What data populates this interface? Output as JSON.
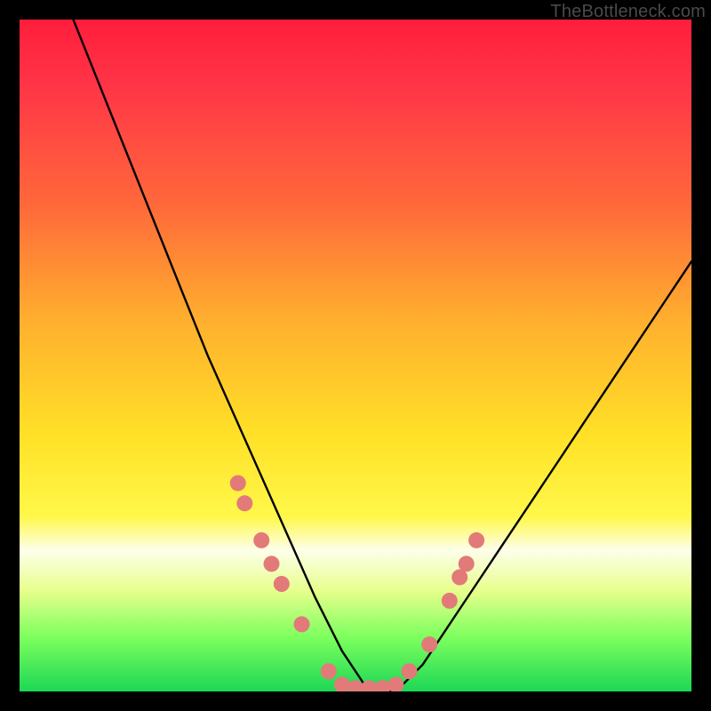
{
  "watermark": "TheBottleneck.com",
  "chart_data": {
    "type": "line",
    "title": "",
    "xlabel": "",
    "ylabel": "",
    "xlim": [
      0,
      100
    ],
    "ylim": [
      0,
      100
    ],
    "series": [
      {
        "name": "bottleneck-curve",
        "x": [
          8,
          12,
          16,
          20,
          24,
          28,
          32,
          36,
          40,
          44,
          48,
          52,
          56,
          60,
          64,
          68,
          72,
          76,
          80,
          84,
          88,
          92,
          96,
          100
        ],
        "y": [
          100,
          90,
          80,
          70,
          60,
          50,
          41,
          32,
          23,
          14,
          6,
          0,
          0,
          4,
          10,
          16,
          22,
          28,
          34,
          40,
          46,
          52,
          58,
          64
        ]
      }
    ],
    "markers": {
      "name": "highlighted-points",
      "color": "#e27a7a",
      "points": [
        {
          "x": 32.5,
          "y": 31
        },
        {
          "x": 33.5,
          "y": 28
        },
        {
          "x": 36,
          "y": 22.5
        },
        {
          "x": 37.5,
          "y": 19
        },
        {
          "x": 39,
          "y": 16
        },
        {
          "x": 42,
          "y": 10
        },
        {
          "x": 46,
          "y": 3
        },
        {
          "x": 48,
          "y": 1
        },
        {
          "x": 50,
          "y": 0.5
        },
        {
          "x": 52,
          "y": 0.5
        },
        {
          "x": 54,
          "y": 0.5
        },
        {
          "x": 56,
          "y": 1
        },
        {
          "x": 58,
          "y": 3
        },
        {
          "x": 61,
          "y": 7
        },
        {
          "x": 64,
          "y": 13.5
        },
        {
          "x": 65.5,
          "y": 17
        },
        {
          "x": 66.5,
          "y": 19
        },
        {
          "x": 68,
          "y": 22.5
        }
      ]
    }
  }
}
